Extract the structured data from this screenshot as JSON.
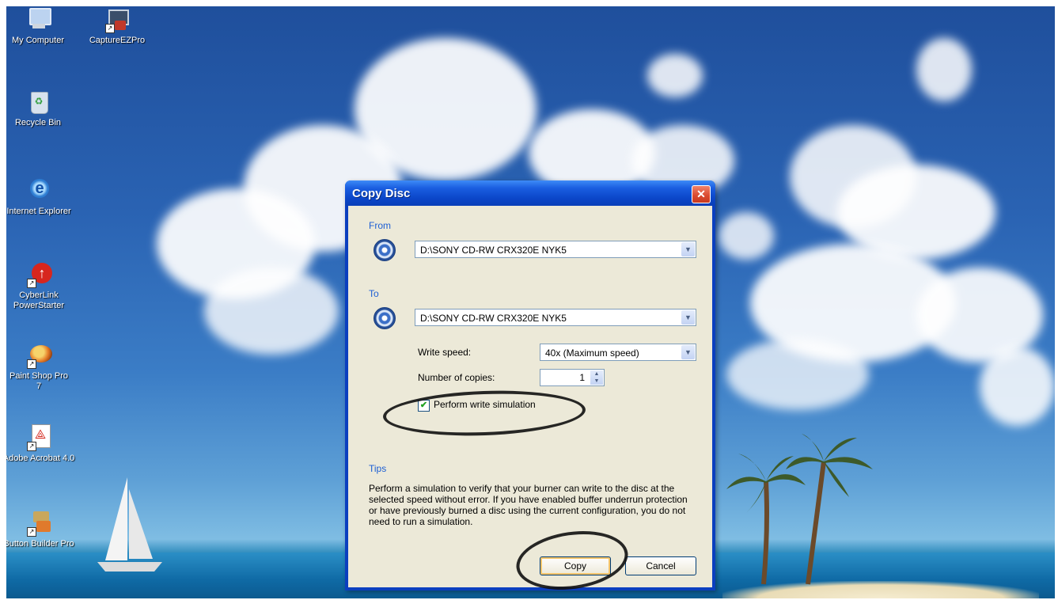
{
  "desktop": {
    "icons": [
      {
        "label": "My Computer",
        "icon": "my-computer-icon"
      },
      {
        "label": "CaptureEZPro",
        "icon": "capture-app-icon"
      },
      {
        "label": "Recycle Bin",
        "icon": "recycle-bin-icon"
      },
      {
        "label": "Internet Explorer",
        "icon": "internet-explorer-icon"
      },
      {
        "label": "CyberLink PowerStarter",
        "icon": "cyberlink-powerstarter-icon"
      },
      {
        "label": "Paint Shop Pro 7",
        "icon": "paint-shop-pro-icon"
      },
      {
        "label": "Adobe Acrobat 4.0",
        "icon": "adobe-acrobat-icon"
      },
      {
        "label": "Button Builder Pro",
        "icon": "button-builder-icon"
      }
    ]
  },
  "dialog": {
    "title": "Copy Disc",
    "close_glyph": "✕",
    "from_label": "From",
    "from_drive": "D:\\SONY CD-RW CRX320E NYK5",
    "to_label": "To",
    "to_drive": "D:\\SONY CD-RW CRX320E NYK5",
    "write_speed_label": "Write speed:",
    "write_speed_value": "40x (Maximum speed)",
    "copies_label": "Number of copies:",
    "copies_value": "1",
    "simulation_label": "Perform write simulation",
    "simulation_checked": true,
    "tips_label": "Tips",
    "tips_text": "Perform a simulation to verify that your burner can write to the disc at the selected speed without error. If you have enabled buffer underrun protection or have previously burned a disc using the current configuration, you do not need to run a simulation.",
    "copy_button": "Copy",
    "cancel_button": "Cancel"
  },
  "colors": {
    "title_bar": "#0b46c9",
    "section_label": "#1d5fd4",
    "client_bg": "#ece9d8",
    "close_button": "#d9482d"
  }
}
